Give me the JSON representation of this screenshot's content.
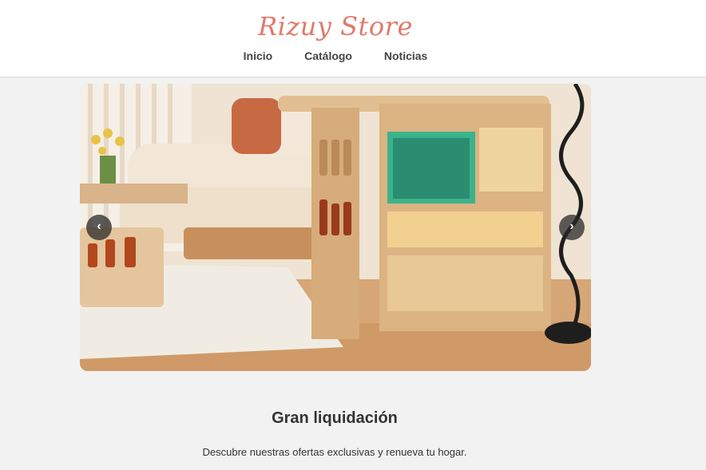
{
  "header": {
    "brand": "Rizuy Store",
    "nav": [
      {
        "label": "Inicio"
      },
      {
        "label": "Catálogo"
      },
      {
        "label": "Noticias"
      }
    ]
  },
  "carousel": {
    "prev_glyph": "‹",
    "next_glyph": "›",
    "image_subject": "living-room-bar-cabinet-with-aquarium"
  },
  "promo": {
    "title": "Gran liquidación",
    "subtitle": "Descubre nuestras ofertas exclusivas y renueva tu hogar."
  },
  "colors": {
    "brand": "#e07a6b",
    "text": "#333333",
    "background": "#f2f2f2"
  }
}
